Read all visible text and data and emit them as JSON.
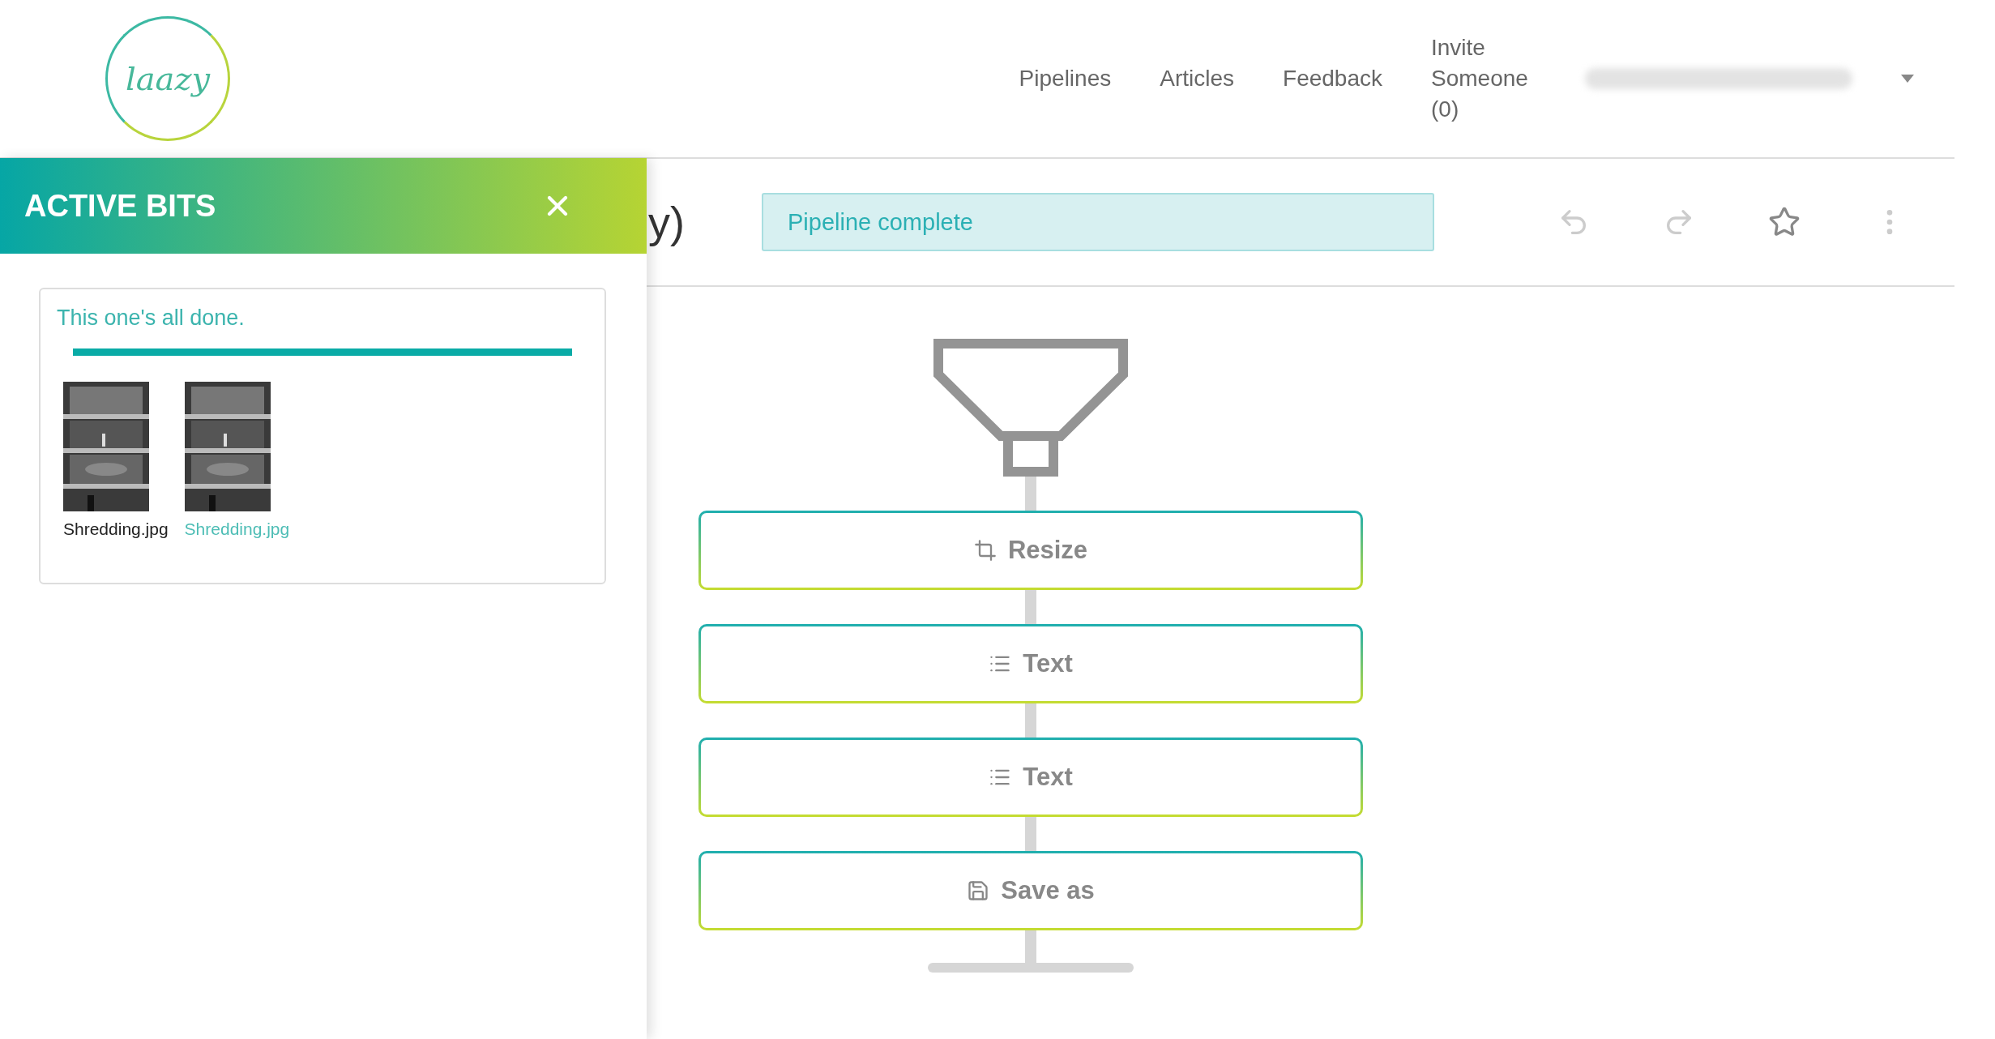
{
  "header": {
    "logo": "laazy",
    "nav": [
      "Pipelines",
      "Articles",
      "Feedback",
      "Invite Someone (0)"
    ],
    "account": {
      "blurred": true
    }
  },
  "toolbar": {
    "title": "y)",
    "status": "Pipeline complete"
  },
  "pipeline": {
    "steps": [
      {
        "kind": "resize",
        "label": "Resize"
      },
      {
        "kind": "text",
        "label": "Text"
      },
      {
        "kind": "text",
        "label": "Text"
      },
      {
        "kind": "save",
        "label": "Save as"
      }
    ]
  },
  "panel": {
    "title": "ACTIVE BITS",
    "message": "This one's all done.",
    "level": 1,
    "files": [
      {
        "name": "Shredding.jpg",
        "selected": false,
        "kind": "picture"
      },
      {
        "name": "Shredding.jpg",
        "selected": true,
        "kind": "picture"
      }
    ]
  }
}
